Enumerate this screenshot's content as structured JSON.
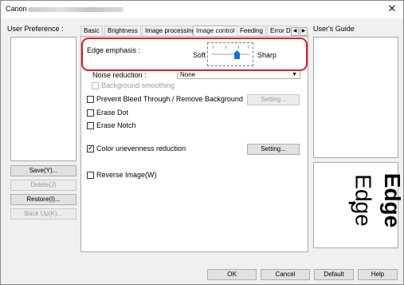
{
  "window": {
    "title": "Canon",
    "close_glyph": "✕"
  },
  "user_preference": {
    "label": "User Preference :",
    "buttons": {
      "save": "Save(Y)...",
      "delete": "Delete(J)",
      "restore": "Restore(I)...",
      "backup": "Back Up(K)..."
    }
  },
  "tabs": [
    "Basic",
    "Brightness",
    "Image processing",
    "Image control",
    "Feeding",
    "Error De"
  ],
  "active_tab": "Image control",
  "tab_scroll": {
    "left": "◀",
    "right": "▶"
  },
  "image_control": {
    "edge_emphasis": {
      "label": "Edge emphasis :",
      "soft_label": "Soft",
      "sharp_label": "Sharp",
      "level": 0.65
    },
    "noise_reduction": {
      "label": "Noise reduction :",
      "value": "None"
    },
    "background_smoothing": {
      "label": "Background smoothing",
      "checked": false,
      "enabled": false
    },
    "prevent_bleed_through": {
      "label": "Prevent Bleed Through / Remove Background",
      "checked": false,
      "setting_label": "Setting..."
    },
    "erase_dot": {
      "label": "Erase Dot",
      "checked": false
    },
    "erase_notch": {
      "label": "Erase Notch",
      "checked": false
    },
    "color_unevenness": {
      "label": "Color unevenness reduction",
      "checked": true,
      "setting_label": "Setting..."
    },
    "reverse_image": {
      "label": "Reverse Image(W)",
      "checked": false
    }
  },
  "users_guide": {
    "label": "User's Guide",
    "preview_text": "Edge",
    "preview_arrow": "➡"
  },
  "footer": {
    "ok": "OK",
    "cancel": "Cancel",
    "default": "Default",
    "help": "Help"
  },
  "colors": {
    "highlight": "#e21b23",
    "slider_thumb": "#0a78d7"
  }
}
